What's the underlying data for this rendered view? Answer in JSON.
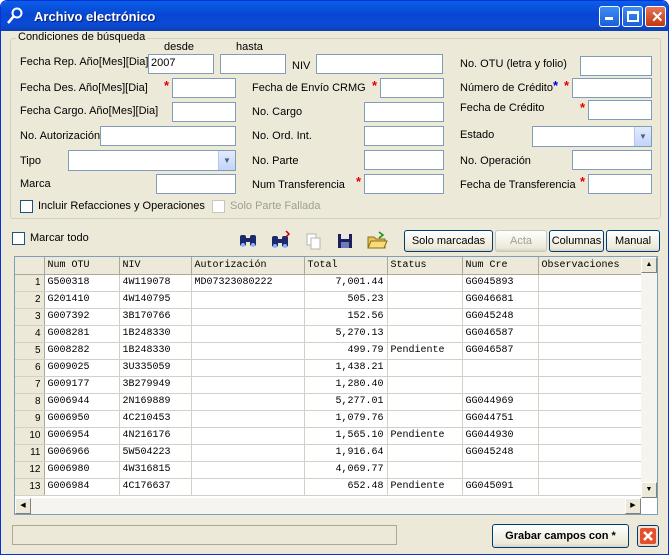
{
  "window": {
    "title": "Archivo electrónico",
    "icon": "key-tool-icon"
  },
  "group": {
    "legend": "Condiciones de búsqueda"
  },
  "labels": {
    "desde": "desde",
    "hasta": "hasta",
    "fecha_rep": "Fecha Rep. Año[Mes][Dia]",
    "niv": "NIV",
    "no_otu": "No. OTU (letra y folio)",
    "fecha_des": "Fecha Des. Año[Mes][Dia]",
    "fecha_envio": "Fecha de Envío CRMG",
    "numero_credito": "Número de Crédito",
    "fecha_cargo": "Fecha Cargo. Año[Mes][Dia]",
    "no_cargo": "No. Cargo",
    "fecha_credito": "Fecha de Crédito",
    "no_autorizacion": "No. Autorización",
    "no_ord_int": "No. Ord. Int.",
    "estado": "Estado",
    "tipo": "Tipo",
    "no_parte": "No. Parte",
    "no_operacion": "No. Operación",
    "marca": "Marca",
    "num_transferencia": "Num Transferencia",
    "fecha_transferencia": "Fecha de Transferencia",
    "incluir": "Incluir Refacciones y Operaciones",
    "solo_parte": "Solo Parte Fallada",
    "marcar_todo": "Marcar todo",
    "required": "*"
  },
  "fields": {
    "fecha_rep_desde": "2007"
  },
  "toolbar": {
    "solo_marcadas": "Solo marcadas",
    "acta": "Acta",
    "columnas": "Columnas",
    "manual": "Manual"
  },
  "grid": {
    "headers": [
      "Num OTU",
      "NIV",
      "Autorización",
      "Total",
      "Status",
      "Num Cre",
      "Observaciones"
    ],
    "rows": [
      [
        "1",
        "G500318",
        "4W119078",
        "MD07323080222",
        "7,001.44",
        "",
        "GG045893",
        ""
      ],
      [
        "2",
        "G201410",
        "4W140795",
        "",
        "505.23",
        "",
        "GG046681",
        ""
      ],
      [
        "3",
        "G007392",
        "3B170766",
        "",
        "152.56",
        "",
        "GG045248",
        ""
      ],
      [
        "4",
        "G008281",
        "1B248330",
        "",
        "5,270.13",
        "",
        "GG046587",
        ""
      ],
      [
        "5",
        "G008282",
        "1B248330",
        "",
        "499.79",
        "Pendiente",
        "GG046587",
        ""
      ],
      [
        "6",
        "G009025",
        "3U335059",
        "",
        "1,438.21",
        "",
        "",
        ""
      ],
      [
        "7",
        "G009177",
        "3B279949",
        "",
        "1,280.40",
        "",
        "",
        ""
      ],
      [
        "8",
        "G006944",
        "2N169889",
        "",
        "5,277.01",
        "",
        "GG044969",
        ""
      ],
      [
        "9",
        "G006950",
        "4C210453",
        "",
        "1,079.76",
        "",
        "GG044751",
        ""
      ],
      [
        "10",
        "G006954",
        "4N216176",
        "",
        "1,565.10",
        "Pendiente",
        "GG044930",
        ""
      ],
      [
        "11",
        "G006966",
        "5W504223",
        "",
        "1,916.64",
        "",
        "GG045248",
        ""
      ],
      [
        "12",
        "G006980",
        "4W316815",
        "",
        "4,069.77",
        "",
        "",
        ""
      ],
      [
        "13",
        "G006984",
        "4C176637",
        "",
        "652.48",
        "Pendiente",
        "GG045091",
        ""
      ]
    ]
  },
  "footer": {
    "grabar": "Grabar campos con *"
  }
}
